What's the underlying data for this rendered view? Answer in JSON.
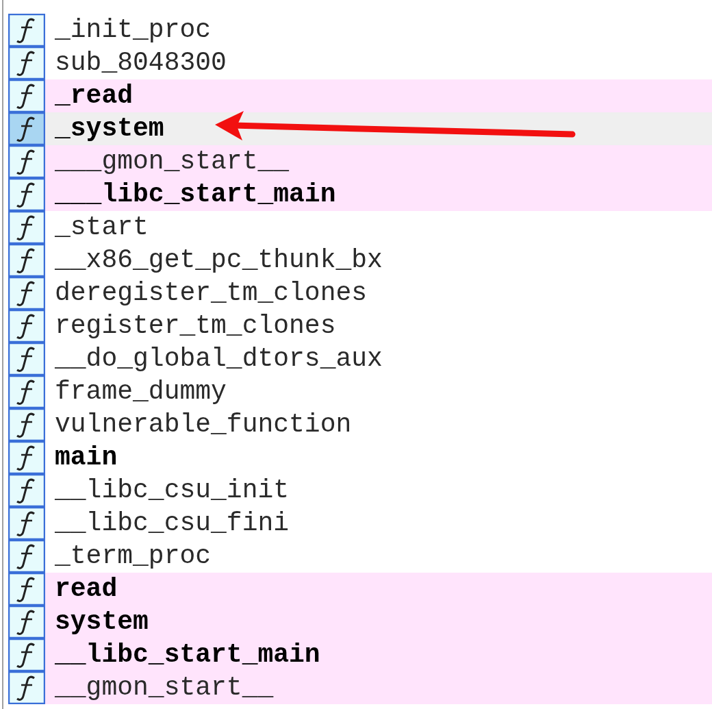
{
  "functions": [
    {
      "name": "_init_proc",
      "imported": false,
      "bold": false,
      "selected": false
    },
    {
      "name": "sub_8048300",
      "imported": false,
      "bold": false,
      "selected": false
    },
    {
      "name": "_read",
      "imported": true,
      "bold": true,
      "selected": false
    },
    {
      "name": "_system",
      "imported": true,
      "bold": true,
      "selected": true
    },
    {
      "name": "___gmon_start__",
      "imported": true,
      "bold": false,
      "selected": false
    },
    {
      "name": "___libc_start_main",
      "imported": true,
      "bold": true,
      "selected": false
    },
    {
      "name": "_start",
      "imported": false,
      "bold": false,
      "selected": false
    },
    {
      "name": "__x86_get_pc_thunk_bx",
      "imported": false,
      "bold": false,
      "selected": false
    },
    {
      "name": "deregister_tm_clones",
      "imported": false,
      "bold": false,
      "selected": false
    },
    {
      "name": "register_tm_clones",
      "imported": false,
      "bold": false,
      "selected": false
    },
    {
      "name": "__do_global_dtors_aux",
      "imported": false,
      "bold": false,
      "selected": false
    },
    {
      "name": "frame_dummy",
      "imported": false,
      "bold": false,
      "selected": false
    },
    {
      "name": "vulnerable_function",
      "imported": false,
      "bold": false,
      "selected": false
    },
    {
      "name": "main",
      "imported": false,
      "bold": true,
      "selected": false
    },
    {
      "name": "__libc_csu_init",
      "imported": false,
      "bold": false,
      "selected": false
    },
    {
      "name": "__libc_csu_fini",
      "imported": false,
      "bold": false,
      "selected": false
    },
    {
      "name": "_term_proc",
      "imported": false,
      "bold": false,
      "selected": false
    },
    {
      "name": "read",
      "imported": true,
      "bold": true,
      "selected": false
    },
    {
      "name": "system",
      "imported": true,
      "bold": true,
      "selected": false
    },
    {
      "name": "__libc_start_main",
      "imported": true,
      "bold": true,
      "selected": false
    },
    {
      "name": "__gmon_start__",
      "imported": true,
      "bold": false,
      "selected": false
    }
  ],
  "annotation": {
    "kind": "arrow"
  }
}
